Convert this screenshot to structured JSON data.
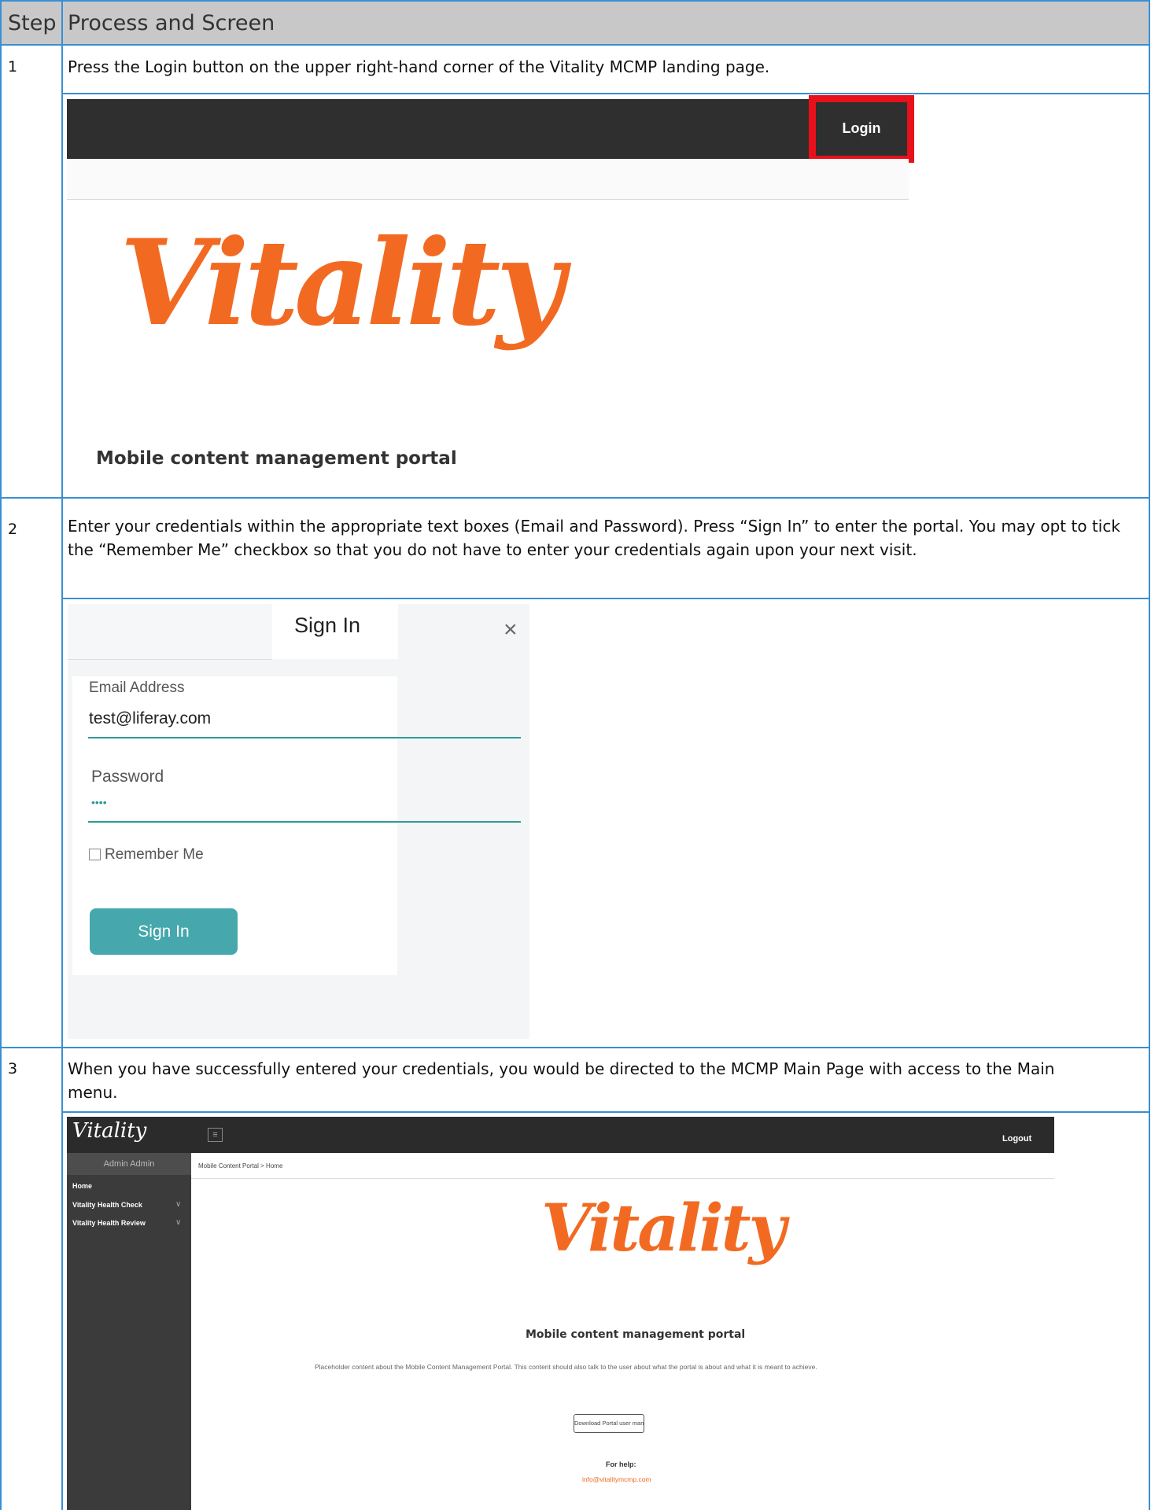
{
  "header": {
    "step": "Step",
    "process": "Process and Screen"
  },
  "steps": [
    {
      "num": "1",
      "text": "Press the Login button on the upper right-hand corner of the Vitality MCMP landing page."
    },
    {
      "num": "2",
      "text": "Enter your credentials within the appropriate text boxes (Email and Password). Press “Sign In” to enter the portal. You may opt to tick the “Remember Me” checkbox so that you do not have to enter your credentials again upon your next visit."
    },
    {
      "num": "3",
      "text": "When you have successfully entered your credentials, you would be directed to the MCMP Main Page with access to the Main menu."
    }
  ],
  "shot1": {
    "login": "Login",
    "logo": "Vitality",
    "title": "Mobile content management portal"
  },
  "shot2": {
    "title": "Sign In",
    "close": "×",
    "email_label": "Email Address",
    "email_value": "test@liferay.com",
    "password_label": "Password",
    "password_value": "••••",
    "remember": "Remember Me",
    "signin": "Sign In"
  },
  "shot3": {
    "logo": "Vitality",
    "menu_icon": "≡",
    "logout": "Logout",
    "admin": "Admin Admin",
    "nav": [
      "Home",
      "Vitality Health Check",
      "Vitality Health Review"
    ],
    "chevron": "∨",
    "breadcrumb": "Mobile Content Portal  >  Home",
    "logo_main": "Vitality",
    "title": "Mobile content management portal",
    "paragraph": "Placeholder content about the Mobile Content Management Portal. This content should also talk to the user about what the portal is about and what it is meant to achieve.",
    "download": "Download Portal user manua",
    "help": "For help:",
    "email": "info@vitalitymcmp.com"
  }
}
